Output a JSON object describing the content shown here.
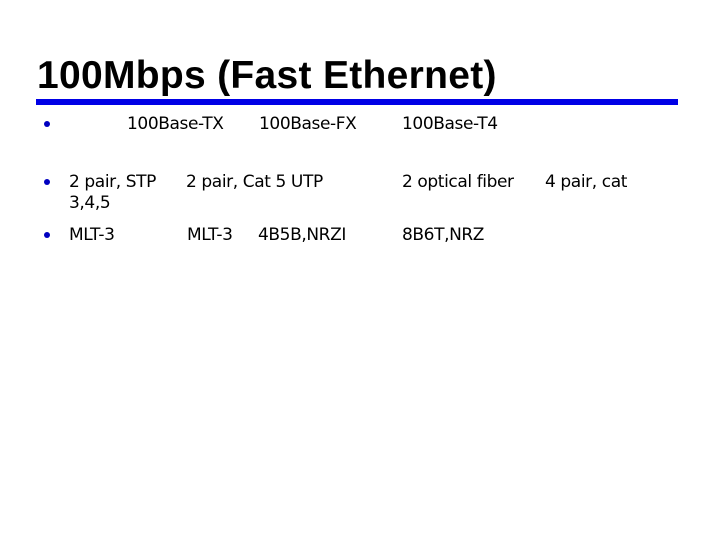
{
  "slide": {
    "title": "100Mbps (Fast Ethernet)",
    "accent_color": "#0000e6",
    "bullet_color": "#0000c0"
  },
  "table": {
    "header": [
      "100Base-TX",
      "100Base-FX",
      "100Base-T4"
    ],
    "rows": [
      {
        "cells": [
          "2 pair, STP",
          "2 pair, Cat 5 UTP",
          "2 optical fiber",
          "4 pair, cat"
        ],
        "continuation": "3,4,5"
      },
      {
        "cells": [
          "MLT-3",
          "MLT-3",
          "4B5B,NRZI",
          "8B6T,NRZ"
        ]
      }
    ]
  }
}
